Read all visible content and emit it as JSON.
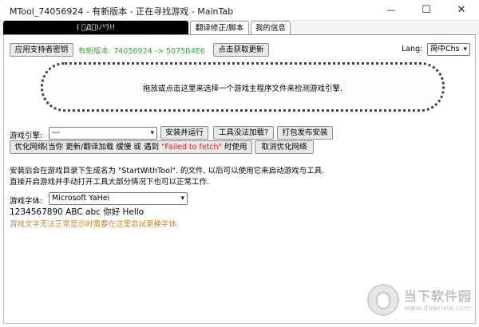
{
  "window": {
    "title": "MTool_74056924 - 有新版本 - 正在寻找游戏 - MainTab",
    "minimize": "—",
    "maximize": "☐",
    "close": "✕"
  },
  "tabs": [
    {
      "label": "( ゚Д゚)ﾉ⁾⁾ﾗ!!"
    },
    {
      "label": "翻译修正/脚本"
    },
    {
      "label": "我的信息"
    }
  ],
  "top_bar": {
    "supporter_key_button": "应用支持者密钥",
    "version_text": "有新版本: 74056924 -> 5075B4E6",
    "update_button": "点击获取更新",
    "lang_label": "Lang:",
    "lang_value": "简中Chs"
  },
  "dropzone": {
    "text": "拖放或点击这里来选择一个游戏主程序文件来检测游戏引擎."
  },
  "engine_row": {
    "label": "游戏引擎:",
    "select_value": "---",
    "install_run_button": "安装并运行",
    "tool_not_loaded_button": "工具没法加载?",
    "package_install_button": "打包发布安装"
  },
  "network_row": {
    "optimize_prefix": "优化网络(当你 更新/翻译加载 缓慢 或 遇到 ",
    "optimize_highlight": "\"Failed to fetch\"",
    "optimize_suffix": " 时使用",
    "cancel_button": "取消优化网络"
  },
  "info": {
    "line1": "安装后会在游戏目录下生成名为 \"StartWithTool\". 的文件, 以后可以使用它来启动游戏与工具.",
    "line2": "直接开启游戏并手动打开工具大部分情况下也可以正常工作."
  },
  "font_section": {
    "label": "游戏字体:",
    "font_value": "Microsoft YaHei",
    "sample": "1234567890 ABC abc 你好 Hello",
    "hint": "游戏文字无法正常显示时需要在这里尝试更换字体."
  },
  "watermark": {
    "name": "当下软件园",
    "url": "www.downxia.com"
  },
  "colors": {
    "version_green": "#3aa83a",
    "error_red": "#e02020",
    "hint_orange": "#d08a2a"
  }
}
